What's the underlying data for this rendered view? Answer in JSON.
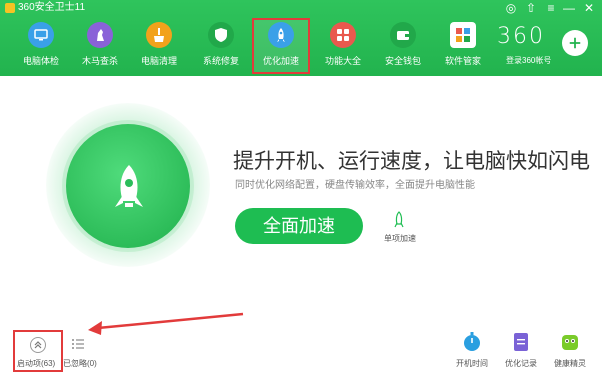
{
  "app": {
    "title": "360安全卫士11",
    "brand": "360",
    "login": "登录360帐号"
  },
  "nav": [
    {
      "label": "电脑体检",
      "icon": "monitor-icon",
      "color": "#3aa0e8"
    },
    {
      "label": "木马查杀",
      "icon": "horse-icon",
      "color": "#8a62d8"
    },
    {
      "label": "电脑清理",
      "icon": "broom-icon",
      "color": "#f2a21c"
    },
    {
      "label": "系统修复",
      "icon": "shield-icon",
      "color": "#21a84a"
    },
    {
      "label": "优化加速",
      "icon": "rocket-icon",
      "color": "#3aa0e8"
    },
    {
      "label": "功能大全",
      "icon": "grid-icon",
      "color": "#e9594e"
    },
    {
      "label": "安全钱包",
      "icon": "wallet-icon",
      "color": "#21a84a"
    },
    {
      "label": "软件管家",
      "icon": "apps-icon",
      "color": "#e7e7e7"
    }
  ],
  "main": {
    "headline": "提升开机、运行速度，让电脑快如闪电",
    "subline": "同时优化网络配置，硬盘传输效率，全面提升电脑性能",
    "accelerate_button": "全面加速",
    "single_item_label": "单项加速"
  },
  "bottom_left": {
    "boot_items": "启动项(63)",
    "ignored": "已忽略(0)"
  },
  "tools": [
    {
      "label": "开机时间",
      "icon": "stopwatch-icon",
      "color": "#2a9fe0"
    },
    {
      "label": "优化记录",
      "icon": "document-icon",
      "color": "#7a62d6"
    },
    {
      "label": "健康精灵",
      "icon": "mascot-icon",
      "color": "#7acb2a"
    }
  ]
}
